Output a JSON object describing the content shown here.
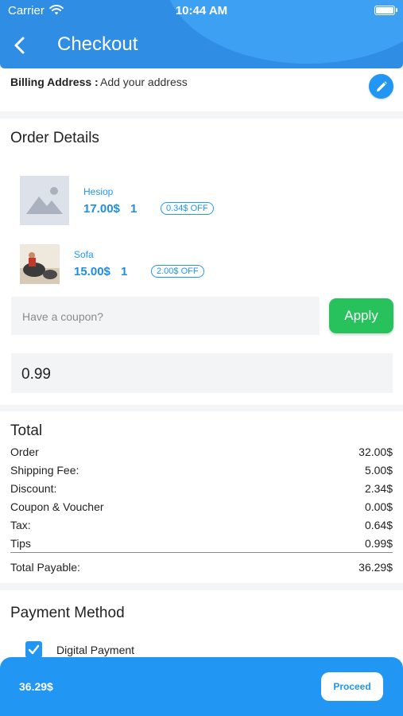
{
  "status_bar": {
    "carrier": "Carrier",
    "time": "10:44 AM"
  },
  "header": {
    "title": "Checkout"
  },
  "billing": {
    "label": "Billing Address :",
    "value": "Add your address"
  },
  "order": {
    "heading": "Order Details",
    "items": [
      {
        "name": "Hesiop",
        "price": "17.00$",
        "qty": "1",
        "discount": "0.34$ OFF"
      },
      {
        "name": "Sofa",
        "price": "15.00$",
        "qty": "1",
        "discount": "2.00$ OFF"
      }
    ],
    "coupon_placeholder": "Have a coupon?",
    "apply_label": "Apply",
    "tips_value": "0.99"
  },
  "totals": {
    "heading": "Total",
    "rows": [
      {
        "label": "Order",
        "value": "32.00$"
      },
      {
        "label": "Shipping Fee:",
        "value": "5.00$"
      },
      {
        "label": "Discount:",
        "value": "2.34$"
      },
      {
        "label": "Coupon & Voucher",
        "value": "0.00$"
      },
      {
        "label": "Tax:",
        "value": "0.64$"
      },
      {
        "label": "Tips",
        "value": "0.99$"
      }
    ],
    "payable_label": "Total Payable:",
    "payable_value": "36.29$"
  },
  "payment": {
    "heading": "Payment Method",
    "option": "Digital Payment",
    "checked": true
  },
  "bottom_bar": {
    "amount": "36.29$",
    "proceed_label": "Proceed"
  },
  "colors": {
    "primary": "#2196f3",
    "header": "#2f8de4",
    "apply": "#27c25c"
  },
  "icons": [
    "wifi-icon",
    "battery-icon",
    "back-arrow-icon",
    "edit-pencil-icon",
    "image-placeholder-icon",
    "checkmark-icon"
  ]
}
